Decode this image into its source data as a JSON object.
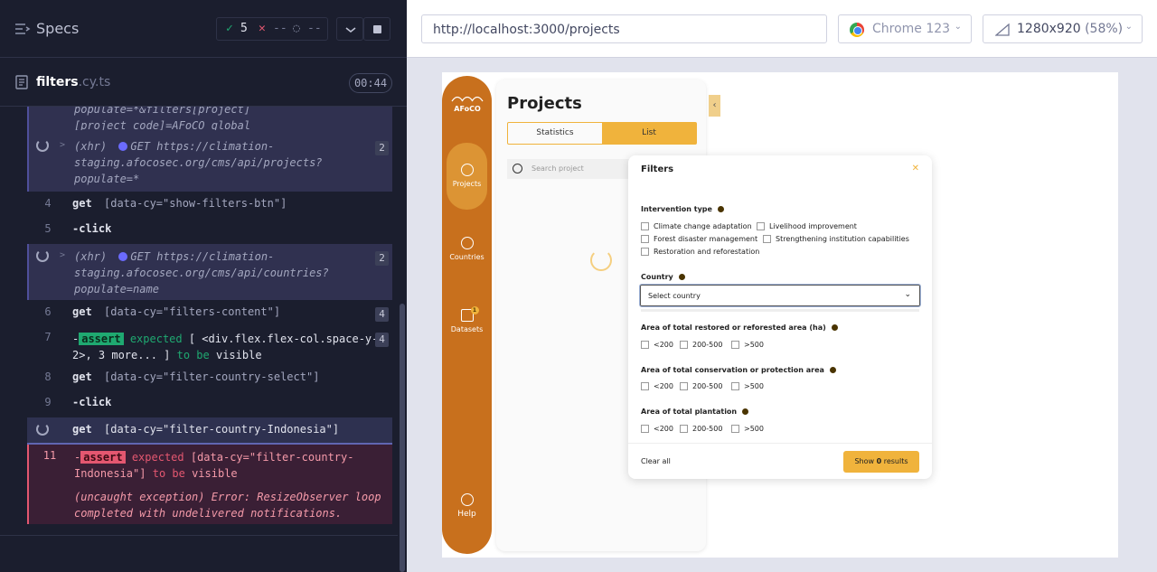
{
  "runner": {
    "specs_label": "Specs",
    "stats": {
      "passed": "5",
      "failed": "--",
      "pending": "--"
    },
    "file": {
      "name": "filters",
      "ext": ".cy.ts",
      "duration": "00:44"
    },
    "log": {
      "row0_text": "populate=*&filters[project][project_code]=AFoCO_global",
      "xhr1": {
        "prefix": "(xhr)",
        "method": "GET",
        "url": "https://climation-staging.afocosec.org/cms/api/projects?populate=*",
        "count": "2"
      },
      "row4": {
        "num": "4",
        "cmd": "get",
        "msg": "[data-cy=\"show-filters-btn\"]"
      },
      "row5": {
        "num": "5",
        "cmd": "-click"
      },
      "xhr2": {
        "prefix": "(xhr)",
        "method": "GET",
        "url": "https://climation-staging.afocosec.org/cms/api/countries?populate=name",
        "count": "2"
      },
      "row6": {
        "num": "6",
        "cmd": "get",
        "msg": "[data-cy=\"filters-content\"]",
        "count": "4"
      },
      "row7": {
        "num": "7",
        "cmd": "-",
        "badge": "assert",
        "kw1": "expected",
        "msg": "[ <div.flex.flex-col.space-y-2>, 3 more... ]",
        "kw2": "to be",
        "tail": "visible",
        "count": "4"
      },
      "row8": {
        "num": "8",
        "cmd": "get",
        "msg": "[data-cy=\"filter-country-select\"]"
      },
      "row9": {
        "num": "9",
        "cmd": "-click"
      },
      "row10": {
        "cmd": "get",
        "msg": "[data-cy=\"filter-country-Indonesia\"]"
      },
      "row11": {
        "num": "11",
        "cmd": "-",
        "badge": "assert",
        "kw1": "expected",
        "msg": "[data-cy=\"filter-country-Indonesia\"]",
        "kw2": "to be",
        "tail": "visible",
        "exception": "(uncaught exception)  Error: ResizeObserver loop completed with undelivered notifications."
      }
    }
  },
  "browser": {
    "url": "http://localhost:3000/projects",
    "name": "Chrome 123",
    "viewport": "1280x920",
    "scale": "(58%)"
  },
  "app": {
    "logo_text": "AFoCO",
    "nav": {
      "projects": "Projects",
      "countries": "Countries",
      "datasets": "Datasets",
      "datasets_badge": "1",
      "help": "Help"
    },
    "title": "Projects",
    "tabs": {
      "statistics": "Statistics",
      "list": "List"
    },
    "search_placeholder": "Search project",
    "filters": {
      "title": "Filters",
      "intervention_title": "Intervention type",
      "intervention": [
        "Climate change adaptation",
        "Livelihood improvement",
        "Forest disaster management",
        "Strengthening institution capabilities",
        "Restoration and reforestation"
      ],
      "country_title": "Country",
      "country_placeholder": "Select country",
      "area_restored_title": "Area of total restored or reforested area (ha)",
      "area_conservation_title": "Area of total conservation or protection area",
      "area_plantation_title": "Area of total plantation",
      "ranges": [
        "<200",
        "200-500",
        ">500"
      ],
      "clear_all": "Clear all",
      "show_prefix": "Show",
      "show_count": "0",
      "show_suffix": "results"
    }
  }
}
